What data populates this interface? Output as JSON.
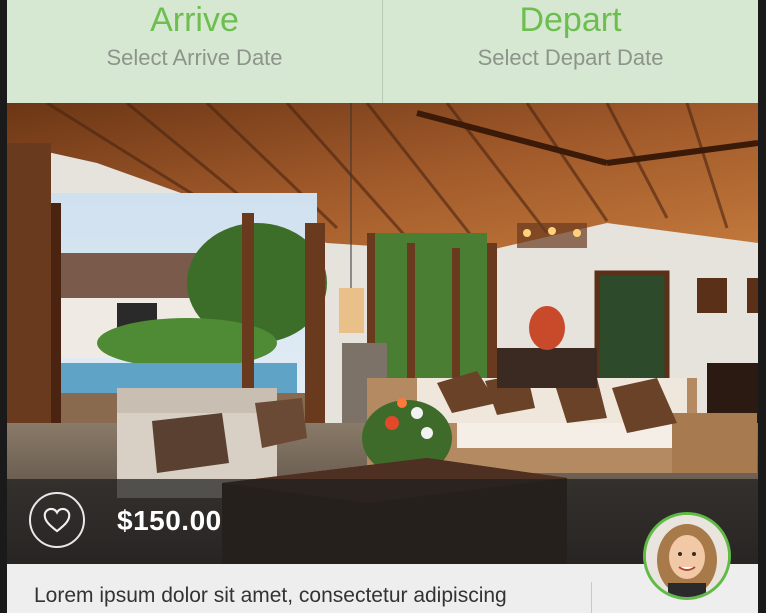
{
  "dates": {
    "arrive": {
      "title": "Arrive",
      "subtitle": "Select Arrive Date"
    },
    "depart": {
      "title": "Depart",
      "subtitle": "Select Depart Date"
    }
  },
  "listing": {
    "price": "$150.00",
    "description": "Lorem ipsum dolor sit amet, consectetur adipiscing",
    "favorite_icon": "heart-outline-icon",
    "image_alt": "villa-living-room-photo"
  },
  "colors": {
    "accent_green": "#6cbf4f",
    "date_bar_bg": "#d7e8d2",
    "subtitle_gray": "#8d948b",
    "overlay": "#1e1e1e"
  }
}
